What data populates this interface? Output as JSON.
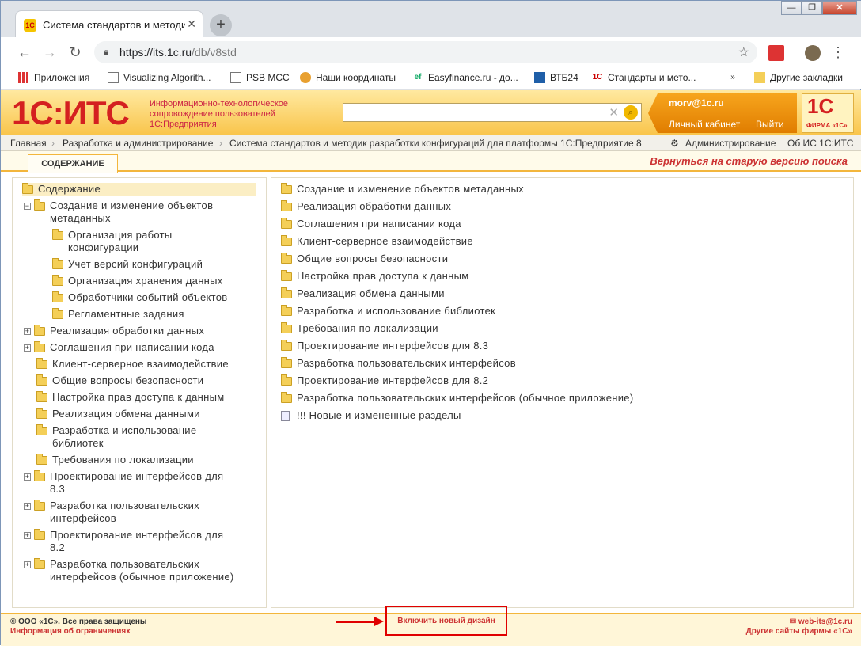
{
  "browser": {
    "tab_title": "Система стандартов и методик",
    "favicon": "1С",
    "url_host": "https://its.1c.ru",
    "url_path": "/db/v8std",
    "new_tab": "+",
    "close": "✕",
    "win_min": "—",
    "win_max": "❐",
    "win_close": "✕"
  },
  "bookmarks": [
    {
      "label": "Приложения",
      "icon": "apps-icon"
    },
    {
      "label": "Visualizing Algorith...",
      "icon": "page-icon"
    },
    {
      "label": "PSB MCC",
      "icon": "page-icon"
    },
    {
      "label": "Наши координаты",
      "icon": "map-icon"
    },
    {
      "label": "Easyfinance.ru - до...",
      "icon": "ef-icon"
    },
    {
      "label": "ВТБ24",
      "icon": "bank-icon"
    },
    {
      "label": "Стандарты и мето...",
      "icon": "1c-icon"
    },
    {
      "label": "Другие закладки",
      "icon": "folder-icon"
    }
  ],
  "header": {
    "logo": "1С:ИТС",
    "tagline": [
      "Информационно-технологическое",
      "сопровождение пользователей",
      "1С:Предприятия"
    ],
    "email": "morv@1c.ru",
    "cabinet": "Личный кабинет",
    "logout": "Выйти",
    "firm_logo": "1С",
    "firm_caption": "ФИРМА «1С»"
  },
  "breadcrumb": [
    "Главная",
    "Разработка и администрирование",
    "Система стандартов и методик разработки конфигураций для платформы 1С:Предприятие 8"
  ],
  "admin": "Администрирование",
  "about": "Об ИС 1С:ИТС",
  "tabs": {
    "contents": "СОДЕРЖАНИЕ",
    "back": "Вернуться на старую версию поиска"
  },
  "tree": [
    {
      "text": [
        "Содержание"
      ],
      "toggle": ""
    },
    {
      "text": [
        "Создание и изменение объектов",
        "метаданных"
      ],
      "toggle": "−"
    },
    {
      "text": [
        "Организация работы",
        "конфигурации"
      ],
      "toggle": ""
    },
    {
      "text": [
        "Учет версий конфигураций"
      ],
      "toggle": ""
    },
    {
      "text": [
        "Организация хранения данных"
      ],
      "toggle": ""
    },
    {
      "text": [
        "Обработчики событий объектов"
      ],
      "toggle": ""
    },
    {
      "text": [
        "Регламентные задания"
      ],
      "toggle": ""
    },
    {
      "text": [
        "Реализация обработки данных"
      ],
      "toggle": "+"
    },
    {
      "text": [
        "Соглашения при написании кода"
      ],
      "toggle": "+"
    },
    {
      "text": [
        "Клиент-серверное взаимодействие"
      ],
      "toggle": ""
    },
    {
      "text": [
        "Общие вопросы безопасности"
      ],
      "toggle": ""
    },
    {
      "text": [
        "Настройка прав доступа к данным"
      ],
      "toggle": ""
    },
    {
      "text": [
        "Реализация обмена данными"
      ],
      "toggle": ""
    },
    {
      "text": [
        "Разработка и использование",
        "библиотек"
      ],
      "toggle": ""
    },
    {
      "text": [
        "Требования по локализации"
      ],
      "toggle": ""
    },
    {
      "text": [
        "Проектирование интерфейсов для",
        "8.3"
      ],
      "toggle": "+"
    },
    {
      "text": [
        "Разработка пользовательских",
        "интерфейсов"
      ],
      "toggle": "+"
    },
    {
      "text": [
        "Проектирование интерфейсов для",
        "8.2"
      ],
      "toggle": "+"
    },
    {
      "text": [
        "Разработка пользовательских",
        "интерфейсов (обычное приложение)"
      ],
      "toggle": "+"
    }
  ],
  "content_list": [
    "Создание и изменение объектов метаданных",
    "Реализация обработки данных",
    "Соглашения при написании кода",
    "Клиент-серверное взаимодействие",
    "Общие вопросы безопасности",
    "Настройка прав доступа к данным",
    "Реализация обмена данными",
    "Разработка и использование библиотек",
    "Требования по локализации",
    "Проектирование интерфейсов для 8.3",
    "Разработка пользовательских интерфейсов",
    "Проектирование интерфейсов для 8.2",
    "Разработка пользовательских интерфейсов (обычное приложение)",
    "!!! Новые и измененные разделы"
  ],
  "footer": {
    "copyright": "© ООО «1С». Все права защищены",
    "limits": "Информация об ограничениях",
    "new_design": "Включить новый дизайн",
    "web_its": "web-its@1c.ru",
    "other_sites": "Другие сайты фирмы «1С»"
  },
  "colors": {
    "accent": "#f3b63c",
    "brand_red": "#d42020"
  }
}
